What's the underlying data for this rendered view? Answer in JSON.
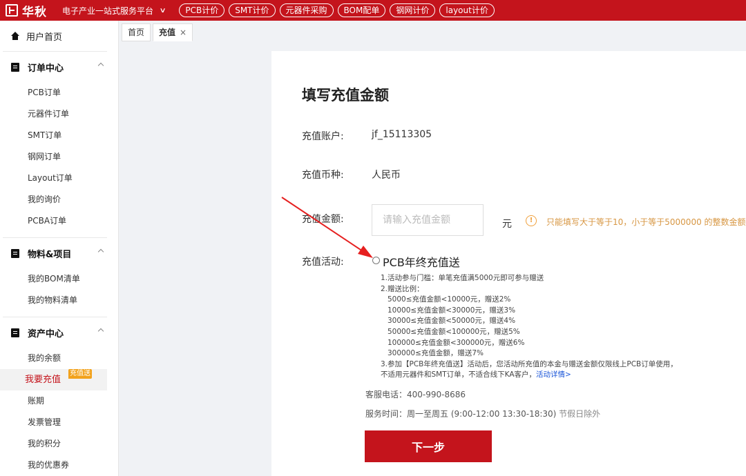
{
  "topbar": {
    "logo_text": "华秋",
    "platform": "电子产业一站式服务平台",
    "links": [
      "PCB计价",
      "SMT计价",
      "元器件采购",
      "BOM配单",
      "钢网计价",
      "layout计价"
    ]
  },
  "sidebar": {
    "home": "用户首页",
    "groups": [
      {
        "title": "订单中心",
        "items": [
          "PCB订单",
          "元器件订单",
          "SMT订单",
          "钢网订单",
          "Layout订单",
          "我的询价",
          "PCBA订单"
        ]
      },
      {
        "title": "物料&项目",
        "items": [
          "我的BOM清单",
          "我的物料清单"
        ]
      },
      {
        "title": "资产中心",
        "items": [
          "我的余额",
          "我要充值",
          "账期",
          "发票管理",
          "我的积分",
          "我的优惠券"
        ],
        "active_index": 1,
        "active_tag": "充值送"
      }
    ]
  },
  "tabs": [
    {
      "label": "首页"
    },
    {
      "label": "充值",
      "close": "×"
    }
  ],
  "form": {
    "title": "填写充值金额",
    "account_label": "充值账户:",
    "account_value": "jf_15113305",
    "currency_label": "充值币种:",
    "currency_value": "人民币",
    "amount_label": "充值金额:",
    "amount_placeholder": "请输入充值金额",
    "amount_value": "",
    "unit": "元",
    "warning_icon": "!",
    "warning": "只能填写大于等于10，小于等于5000000 的整数金额。",
    "activity_label": "充值活动:",
    "activity_name": "PCB年终充值送",
    "rules": {
      "line1": "1.活动参与门槛：单笔充值满5000元即可参与赠送",
      "line2": "2.赠送比例：",
      "tiers": [
        "5000≤充值金额<10000元，赠送2%",
        "10000≤充值金额<30000元，赠送3%",
        "30000≤充值金额<50000元，赠送4%",
        "50000≤充值金额<100000元，赠送5%",
        "100000≤充值金额<300000元，赠送6%",
        "300000≤充值金额，赠送7%"
      ],
      "line3": "3.参加【PCB年终充值送】活动后，您活动所充值的本金与赠送金额仅限线上PCB订单使用，",
      "line4": "不适用元器件和SMT订单，不适合线下KA客户，",
      "detail_link": "活动详情>"
    },
    "hotline": "客服电话：400-990-8686",
    "service_time": "服务时间：周一至周五 (9:00-12:00 13:30-18:30)",
    "holiday": " 节假日除外",
    "next_button": "下一步"
  },
  "colors": {
    "brand_red": "#c4141c",
    "warning_orange": "#d79642",
    "tag_orange": "#f2a21c",
    "link_blue": "#1a55d8"
  },
  "icons": {
    "home": "home-icon",
    "orders": "clipboard-icon",
    "materials": "clipboard-check-icon",
    "assets": "wallet-icon",
    "caret": "chevron-up-icon",
    "warning": "warning-circle-icon",
    "arrow": "annotation-arrow-icon"
  }
}
